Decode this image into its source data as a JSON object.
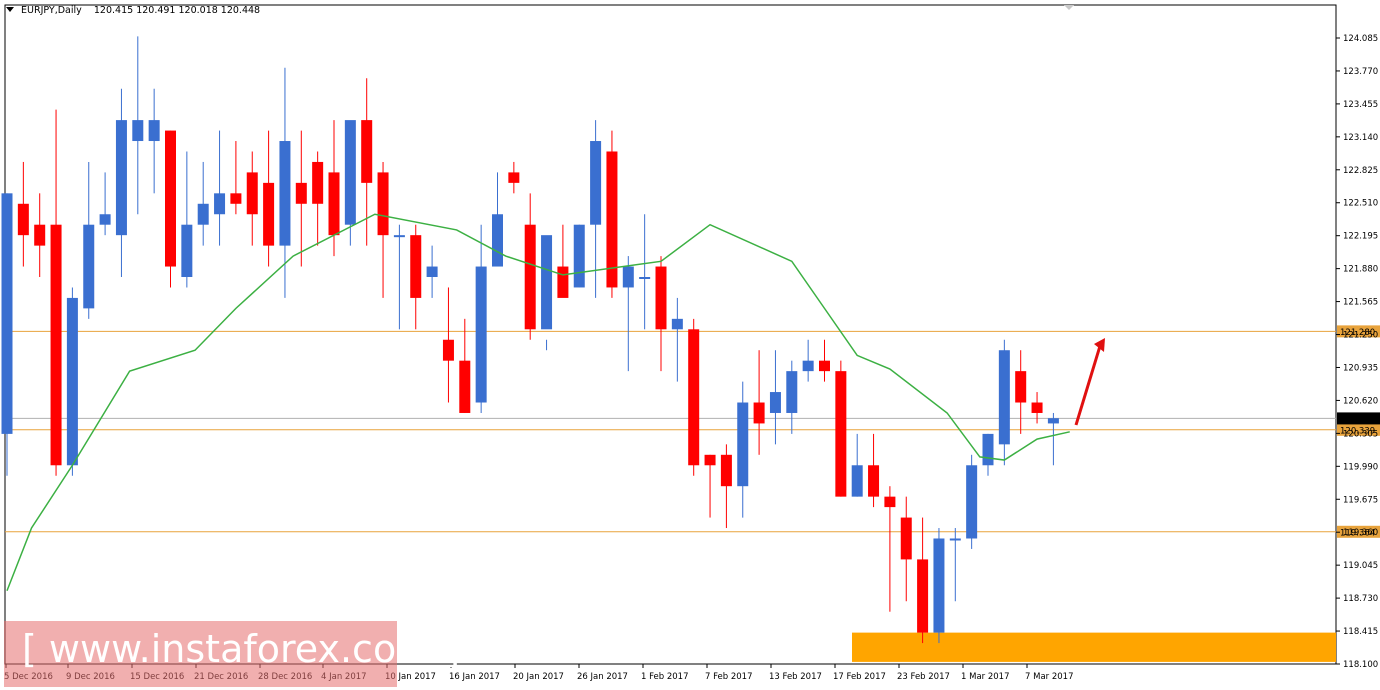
{
  "header": {
    "symbol": "EURJPY,Daily",
    "ohlc": "120.415 120.491 120.018 120.448"
  },
  "watermark": {
    "text": "[ www.instaforex.com ]"
  },
  "colors": {
    "bull": "#3a6fd0",
    "bear": "#ff0000",
    "ma": "#3cb043",
    "level": "#e8a33c",
    "zone": "#ffa500",
    "arrow": "#e01010",
    "current": "#b0b0b0"
  },
  "chart_data": {
    "type": "candlestick",
    "ylim": [
      118.05,
      124.3
    ],
    "yticks": [
      "124.085",
      "123.770",
      "123.455",
      "123.140",
      "122.825",
      "122.510",
      "122.195",
      "121.880",
      "121.565",
      "121.250",
      "120.935",
      "120.620",
      "120.305",
      "119.990",
      "119.675",
      "119.360",
      "119.045",
      "118.730",
      "118.415",
      "118.100"
    ],
    "xticks": [
      "5 Dec 2016",
      "9 Dec 2016",
      "15 Dec 2016",
      "21 Dec 2016",
      "28 Dec 2016",
      "4 Jan 2017",
      "10 Jan 2017",
      "16 Jan 2017",
      "20 Jan 2017",
      "26 Jan 2017",
      "1 Feb 2017",
      "7 Feb 2017",
      "13 Feb 2017",
      "17 Feb 2017",
      "23 Feb 2017",
      "1 Mar 2017",
      "7 Mar 2017"
    ],
    "levels": [
      {
        "label": "121.280",
        "value": 121.28
      },
      {
        "label": "120.339",
        "value": 120.339
      },
      {
        "label": "119.364",
        "value": 119.364
      }
    ],
    "current": {
      "label": "120.448",
      "value": 120.448
    },
    "support_zone": [
      118.12,
      118.4
    ],
    "candles": [
      [
        120.3,
        122.6,
        119.9,
        122.6
      ],
      [
        122.5,
        122.9,
        121.9,
        122.2
      ],
      [
        122.3,
        122.6,
        121.8,
        122.1
      ],
      [
        122.3,
        123.4,
        119.9,
        120.0
      ],
      [
        120.0,
        121.7,
        119.9,
        121.6
      ],
      [
        121.5,
        122.9,
        121.4,
        122.3
      ],
      [
        122.3,
        122.8,
        122.2,
        122.4
      ],
      [
        122.2,
        123.6,
        121.8,
        123.3
      ],
      [
        123.1,
        124.1,
        122.4,
        123.3
      ],
      [
        123.1,
        123.6,
        122.6,
        123.3
      ],
      [
        123.2,
        123.2,
        121.7,
        121.9
      ],
      [
        121.8,
        123.0,
        121.7,
        122.3
      ],
      [
        122.3,
        122.9,
        122.1,
        122.5
      ],
      [
        122.4,
        123.2,
        122.1,
        122.6
      ],
      [
        122.6,
        123.1,
        122.4,
        122.5
      ],
      [
        122.8,
        123.0,
        122.1,
        122.4
      ],
      [
        122.7,
        123.2,
        121.9,
        122.1
      ],
      [
        122.1,
        123.8,
        121.6,
        123.1
      ],
      [
        122.7,
        123.2,
        121.9,
        122.5
      ],
      [
        122.9,
        123.0,
        122.1,
        122.5
      ],
      [
        122.8,
        123.3,
        122.0,
        122.2
      ],
      [
        122.3,
        123.2,
        122.1,
        123.3
      ],
      [
        123.3,
        123.7,
        122.1,
        122.7
      ],
      [
        122.8,
        122.9,
        121.6,
        122.2
      ],
      [
        122.2,
        122.3,
        121.3,
        122.2
      ],
      [
        122.2,
        122.3,
        121.3,
        121.6
      ],
      [
        121.8,
        122.1,
        121.6,
        121.9
      ],
      [
        121.2,
        121.7,
        120.6,
        121.0
      ],
      [
        121.0,
        121.4,
        120.5,
        120.5
      ],
      [
        120.6,
        122.3,
        120.5,
        121.9
      ],
      [
        121.9,
        122.8,
        121.9,
        122.4
      ],
      [
        122.8,
        122.9,
        122.6,
        122.7
      ],
      [
        122.3,
        122.6,
        121.2,
        121.3
      ],
      [
        121.3,
        121.2,
        121.1,
        122.2
      ],
      [
        121.9,
        122.3,
        121.7,
        121.6
      ],
      [
        121.7,
        122.3,
        121.7,
        122.3
      ],
      [
        122.3,
        123.3,
        121.6,
        123.1
      ],
      [
        123.0,
        123.2,
        121.6,
        121.7
      ],
      [
        121.7,
        122.0,
        120.9,
        121.9
      ],
      [
        121.8,
        122.4,
        121.3,
        121.8
      ],
      [
        121.9,
        122.0,
        120.9,
        121.3
      ],
      [
        121.3,
        121.6,
        120.8,
        121.4
      ],
      [
        121.3,
        121.4,
        119.9,
        120.0
      ],
      [
        120.1,
        120.1,
        119.5,
        120.0
      ],
      [
        120.1,
        120.2,
        119.4,
        119.8
      ],
      [
        119.8,
        120.8,
        119.5,
        120.6
      ],
      [
        120.6,
        121.1,
        120.1,
        120.4
      ],
      [
        120.5,
        121.1,
        120.2,
        120.7
      ],
      [
        120.5,
        121.0,
        120.3,
        120.9
      ],
      [
        120.9,
        121.2,
        120.8,
        121.0
      ],
      [
        121.0,
        121.2,
        120.8,
        120.9
      ],
      [
        120.9,
        121.0,
        119.7,
        119.7
      ],
      [
        119.7,
        120.3,
        119.7,
        120.0
      ],
      [
        120.0,
        120.3,
        119.6,
        119.7
      ],
      [
        119.7,
        119.8,
        118.6,
        119.6
      ],
      [
        119.5,
        119.7,
        118.7,
        119.1
      ],
      [
        119.1,
        119.5,
        118.3,
        118.4
      ],
      [
        118.4,
        119.4,
        118.3,
        119.3
      ],
      [
        119.3,
        119.4,
        118.7,
        119.3
      ],
      [
        119.3,
        120.1,
        119.2,
        120.0
      ],
      [
        120.0,
        120.3,
        119.9,
        120.3
      ],
      [
        120.2,
        121.2,
        120.0,
        121.1
      ],
      [
        120.9,
        121.1,
        120.3,
        120.6
      ],
      [
        120.6,
        120.7,
        120.4,
        120.5
      ],
      [
        120.4,
        120.5,
        120.0,
        120.45
      ]
    ],
    "ma": [
      [
        0,
        118.8
      ],
      [
        3,
        119.4
      ],
      [
        8,
        120.0
      ],
      [
        15,
        120.9
      ],
      [
        23,
        121.1
      ],
      [
        28,
        121.5
      ],
      [
        35,
        122.0
      ],
      [
        45,
        122.4
      ],
      [
        55,
        122.25
      ],
      [
        61,
        122.0
      ],
      [
        68,
        121.82
      ],
      [
        80,
        121.95
      ],
      [
        86,
        122.3
      ],
      [
        96,
        121.95
      ],
      [
        100,
        121.5
      ],
      [
        104,
        121.05
      ],
      [
        108,
        120.92
      ],
      [
        115,
        120.5
      ],
      [
        119,
        120.08
      ],
      [
        122,
        120.05
      ],
      [
        126,
        120.25
      ],
      [
        130,
        120.32
      ]
    ]
  }
}
